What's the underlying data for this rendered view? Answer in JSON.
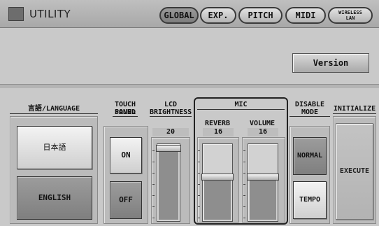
{
  "header": {
    "title": "UTILITY",
    "tabs": [
      {
        "label": "GLOBAL",
        "active": true
      },
      {
        "label": "EXP.",
        "active": false
      },
      {
        "label": "PITCH",
        "active": false
      },
      {
        "label": "MIDI",
        "active": false
      },
      {
        "label": "WIRELESS",
        "label2": "LAN",
        "active": false
      }
    ]
  },
  "version_button": "Version",
  "language": {
    "heading": "言語/LANGUAGE",
    "options": [
      {
        "label": "日本語",
        "selected": false
      },
      {
        "label": "ENGLISH",
        "selected": true
      }
    ]
  },
  "touch_panel_sound": {
    "heading1": "TOUCH PANEL",
    "heading2": "SOUND",
    "options": [
      {
        "label": "ON",
        "selected": false
      },
      {
        "label": "OFF",
        "selected": true
      }
    ]
  },
  "lcd": {
    "heading1": "LCD",
    "heading2": "BRIGHTNESS",
    "value": "20",
    "level": 0.95
  },
  "mic": {
    "heading": "MIC",
    "reverb": {
      "label": "REVERB",
      "value": "16",
      "level": 0.57
    },
    "volume": {
      "label": "VOLUME",
      "value": "16",
      "level": 0.57
    }
  },
  "disable_mode": {
    "heading1": "DISABLE",
    "heading2": "MODE",
    "options": [
      {
        "label": "NORMAL",
        "selected": true
      },
      {
        "label": "TEMPO",
        "selected": false
      }
    ]
  },
  "initialize": {
    "heading": "INITIALIZE",
    "button": "EXECUTE"
  }
}
